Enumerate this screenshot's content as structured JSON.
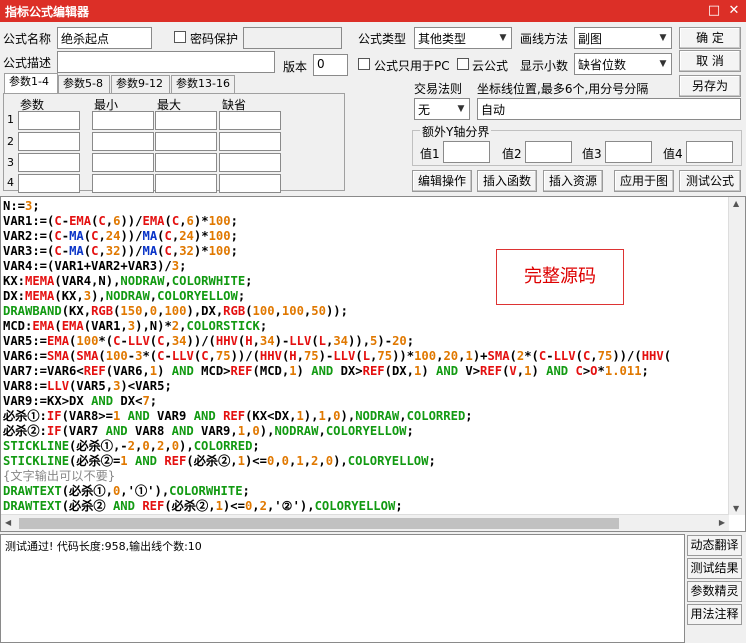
{
  "window": {
    "title": "指标公式编辑器",
    "restore_glyph": "□",
    "close_glyph": "✕"
  },
  "form": {
    "name_label": "公式名称",
    "name_value": "绝杀起点",
    "password_label": "密码保护",
    "desc_label": "公式描述",
    "desc_value": "",
    "version_label": "版本",
    "version_value": "0",
    "type_label": "公式类型",
    "type_value": "其他类型",
    "draw_label": "画线方法",
    "draw_value": "副图",
    "pc_only_label": "公式只用于PC",
    "cloud_label": "云公式",
    "decimal_label": "显示小数",
    "decimal_value": "缺省位数",
    "trade_rule_label": "交易法则",
    "trade_rule_value": "无",
    "coord_label": "坐标线位置,最多6个,用分号分隔",
    "coord_value": "自动",
    "yaxis_label": "额外Y轴分界",
    "val_labels": [
      "值1",
      "值2",
      "值3",
      "值4"
    ]
  },
  "buttons": {
    "ok": "确  定",
    "cancel": "取  消",
    "save_as": "另存为",
    "edit_op": "编辑操作",
    "insert_func": "插入函数",
    "insert_res": "插入资源",
    "apply_chart": "应用于图",
    "test": "测试公式"
  },
  "params": {
    "tabs": [
      "参数1-4",
      "参数5-8",
      "参数9-12",
      "参数13-16"
    ],
    "headers": [
      "参数",
      "最小",
      "最大",
      "缺省"
    ],
    "rows": [
      "1",
      "2",
      "3",
      "4"
    ]
  },
  "code_annotation": "完整源码",
  "code_lines": [
    [
      [
        "N:=",
        "blk"
      ],
      [
        "3",
        "org"
      ],
      [
        ";",
        "blk"
      ]
    ],
    [
      [
        "VAR1:=(",
        "blk"
      ],
      [
        "C",
        "red"
      ],
      [
        "-",
        "blk"
      ],
      [
        "EMA",
        "red"
      ],
      [
        "(",
        "blk"
      ],
      [
        "C",
        "red"
      ],
      [
        ",",
        "blk"
      ],
      [
        "6",
        "org"
      ],
      [
        ")",
        "blk"
      ],
      [
        ")/",
        "blk"
      ],
      [
        "EMA",
        "red"
      ],
      [
        "(",
        "blk"
      ],
      [
        "C",
        "red"
      ],
      [
        ",",
        "blk"
      ],
      [
        "6",
        "org"
      ],
      [
        ")*",
        "blk"
      ],
      [
        "100",
        "org"
      ],
      [
        ";",
        "blk"
      ]
    ],
    [
      [
        "VAR2:=(",
        "blk"
      ],
      [
        "C",
        "red"
      ],
      [
        "-",
        "blk"
      ],
      [
        "MA",
        "blu"
      ],
      [
        "(",
        "blk"
      ],
      [
        "C",
        "red"
      ],
      [
        ",",
        "blk"
      ],
      [
        "24",
        "org"
      ],
      [
        "))/",
        "blk"
      ],
      [
        "MA",
        "blu"
      ],
      [
        "(",
        "blk"
      ],
      [
        "C",
        "red"
      ],
      [
        ",",
        "blk"
      ],
      [
        "24",
        "org"
      ],
      [
        ")*",
        "blk"
      ],
      [
        "100",
        "org"
      ],
      [
        ";",
        "blk"
      ]
    ],
    [
      [
        "VAR3:=(",
        "blk"
      ],
      [
        "C",
        "red"
      ],
      [
        "-",
        "blk"
      ],
      [
        "MA",
        "blu"
      ],
      [
        "(",
        "blk"
      ],
      [
        "C",
        "red"
      ],
      [
        ",",
        "blk"
      ],
      [
        "32",
        "org"
      ],
      [
        "))/",
        "blk"
      ],
      [
        "MA",
        "blu"
      ],
      [
        "(",
        "blk"
      ],
      [
        "C",
        "red"
      ],
      [
        ",",
        "blk"
      ],
      [
        "32",
        "org"
      ],
      [
        ")*",
        "blk"
      ],
      [
        "100",
        "org"
      ],
      [
        ";",
        "blk"
      ]
    ],
    [
      [
        "VAR4:=(VAR1+VAR2+VAR3)/",
        "blk"
      ],
      [
        "3",
        "org"
      ],
      [
        ";",
        "blk"
      ]
    ],
    [
      [
        "KX:",
        "blk"
      ],
      [
        "MEMA",
        "red"
      ],
      [
        "(VAR4,N),",
        "blk"
      ],
      [
        "NODRAW",
        "grn"
      ],
      [
        ",",
        "blk"
      ],
      [
        "COLORWHITE",
        "grn"
      ],
      [
        ";",
        "blk"
      ]
    ],
    [
      [
        "DX:",
        "blk"
      ],
      [
        "MEMA",
        "red"
      ],
      [
        "(KX,",
        "blk"
      ],
      [
        "3",
        "org"
      ],
      [
        "),",
        "blk"
      ],
      [
        "NODRAW",
        "grn"
      ],
      [
        ",",
        "blk"
      ],
      [
        "COLORYELLOW",
        "grn"
      ],
      [
        ";",
        "blk"
      ]
    ],
    [
      [
        "DRAWBAND",
        "grn"
      ],
      [
        "(KX,",
        "blk"
      ],
      [
        "RGB",
        "red"
      ],
      [
        "(",
        "blk"
      ],
      [
        "150",
        "org"
      ],
      [
        ",",
        "blk"
      ],
      [
        "0",
        "org"
      ],
      [
        ",",
        "blk"
      ],
      [
        "100",
        "org"
      ],
      [
        "),DX,",
        "blk"
      ],
      [
        "RGB",
        "red"
      ],
      [
        "(",
        "blk"
      ],
      [
        "100",
        "org"
      ],
      [
        ",",
        "blk"
      ],
      [
        "100",
        "org"
      ],
      [
        ",",
        "blk"
      ],
      [
        "50",
        "org"
      ],
      [
        "));",
        "blk"
      ]
    ],
    [
      [
        "MCD:",
        "blk"
      ],
      [
        "EMA",
        "red"
      ],
      [
        "(",
        "blk"
      ],
      [
        "EMA",
        "red"
      ],
      [
        "(VAR1,",
        "blk"
      ],
      [
        "3",
        "org"
      ],
      [
        "),N)*",
        "blk"
      ],
      [
        "2",
        "org"
      ],
      [
        ",",
        "blk"
      ],
      [
        "COLORSTICK",
        "grn"
      ],
      [
        ";",
        "blk"
      ]
    ],
    [
      [
        "VAR5:=",
        "blk"
      ],
      [
        "EMA",
        "red"
      ],
      [
        "(",
        "blk"
      ],
      [
        "100",
        "org"
      ],
      [
        "*(",
        "blk"
      ],
      [
        "C",
        "red"
      ],
      [
        "-",
        "blk"
      ],
      [
        "LLV",
        "red"
      ],
      [
        "(",
        "blk"
      ],
      [
        "C",
        "red"
      ],
      [
        ",",
        "blk"
      ],
      [
        "34",
        "org"
      ],
      [
        "))/(",
        "blk"
      ],
      [
        "HHV",
        "red"
      ],
      [
        "(",
        "blk"
      ],
      [
        "H",
        "red"
      ],
      [
        ",",
        "blk"
      ],
      [
        "34",
        "org"
      ],
      [
        ")-",
        "blk"
      ],
      [
        "LLV",
        "red"
      ],
      [
        "(",
        "blk"
      ],
      [
        "L",
        "red"
      ],
      [
        ",",
        "blk"
      ],
      [
        "34",
        "org"
      ],
      [
        ")),",
        "blk"
      ],
      [
        "5",
        "org"
      ],
      [
        ")-",
        "blk"
      ],
      [
        "20",
        "org"
      ],
      [
        ";",
        "blk"
      ]
    ],
    [
      [
        "VAR6:=",
        "blk"
      ],
      [
        "SMA",
        "red"
      ],
      [
        "(",
        "blk"
      ],
      [
        "SMA",
        "red"
      ],
      [
        "(",
        "blk"
      ],
      [
        "100",
        "org"
      ],
      [
        "-",
        "blk"
      ],
      [
        "3",
        "org"
      ],
      [
        "*(",
        "blk"
      ],
      [
        "C",
        "red"
      ],
      [
        "-",
        "blk"
      ],
      [
        "LLV",
        "red"
      ],
      [
        "(",
        "blk"
      ],
      [
        "C",
        "red"
      ],
      [
        ",",
        "blk"
      ],
      [
        "75",
        "org"
      ],
      [
        "))/(",
        "blk"
      ],
      [
        "HHV",
        "red"
      ],
      [
        "(",
        "blk"
      ],
      [
        "H",
        "red"
      ],
      [
        ",",
        "blk"
      ],
      [
        "75",
        "org"
      ],
      [
        ")-",
        "blk"
      ],
      [
        "LLV",
        "red"
      ],
      [
        "(",
        "blk"
      ],
      [
        "L",
        "red"
      ],
      [
        ",",
        "blk"
      ],
      [
        "75",
        "org"
      ],
      [
        "))*",
        "blk"
      ],
      [
        "100",
        "org"
      ],
      [
        ",",
        "blk"
      ],
      [
        "20",
        "org"
      ],
      [
        ",",
        "blk"
      ],
      [
        "1",
        "org"
      ],
      [
        ")+",
        "blk"
      ],
      [
        "SMA",
        "red"
      ],
      [
        "(",
        "blk"
      ],
      [
        "2",
        "org"
      ],
      [
        "*(",
        "blk"
      ],
      [
        "C",
        "red"
      ],
      [
        "-",
        "blk"
      ],
      [
        "LLV",
        "red"
      ],
      [
        "(",
        "blk"
      ],
      [
        "C",
        "red"
      ],
      [
        ",",
        "blk"
      ],
      [
        "75",
        "org"
      ],
      [
        "))/(",
        "blk"
      ],
      [
        "HHV",
        "red"
      ],
      [
        "(",
        "blk"
      ]
    ],
    [
      [
        "VAR7:=VAR6<",
        "blk"
      ],
      [
        "REF",
        "red"
      ],
      [
        "(VAR6,",
        "blk"
      ],
      [
        "1",
        "org"
      ],
      [
        ") ",
        "blk"
      ],
      [
        "AND",
        "grn"
      ],
      [
        " MCD>",
        "blk"
      ],
      [
        "REF",
        "red"
      ],
      [
        "(MCD,",
        "blk"
      ],
      [
        "1",
        "org"
      ],
      [
        ") ",
        "blk"
      ],
      [
        "AND",
        "grn"
      ],
      [
        " DX>",
        "blk"
      ],
      [
        "REF",
        "red"
      ],
      [
        "(DX,",
        "blk"
      ],
      [
        "1",
        "org"
      ],
      [
        ") ",
        "blk"
      ],
      [
        "AND",
        "grn"
      ],
      [
        " V>",
        "blk"
      ],
      [
        "REF",
        "red"
      ],
      [
        "(",
        "blk"
      ],
      [
        "V",
        "red"
      ],
      [
        ",",
        "blk"
      ],
      [
        "1",
        "org"
      ],
      [
        ") ",
        "blk"
      ],
      [
        "AND",
        "grn"
      ],
      [
        " ",
        "blk"
      ],
      [
        "C",
        "red"
      ],
      [
        ">",
        "blk"
      ],
      [
        "O",
        "red"
      ],
      [
        "*",
        "blk"
      ],
      [
        "1.011",
        "org"
      ],
      [
        ";",
        "blk"
      ]
    ],
    [
      [
        "VAR8:=",
        "blk"
      ],
      [
        "LLV",
        "red"
      ],
      [
        "(VAR5,",
        "blk"
      ],
      [
        "3",
        "org"
      ],
      [
        ")<VAR5;",
        "blk"
      ]
    ],
    [
      [
        "VAR9:=KX>DX ",
        "blk"
      ],
      [
        "AND",
        "grn"
      ],
      [
        " DX<",
        "blk"
      ],
      [
        "7",
        "org"
      ],
      [
        ";",
        "blk"
      ]
    ],
    [
      [
        "必杀①:",
        "blk"
      ],
      [
        "IF",
        "red"
      ],
      [
        "(VAR8>=",
        "blk"
      ],
      [
        "1",
        "org"
      ],
      [
        " ",
        "blk"
      ],
      [
        "AND",
        "grn"
      ],
      [
        " VAR9 ",
        "blk"
      ],
      [
        "AND",
        "grn"
      ],
      [
        " ",
        "blk"
      ],
      [
        "REF",
        "red"
      ],
      [
        "(KX<DX,",
        "blk"
      ],
      [
        "1",
        "org"
      ],
      [
        "),",
        "blk"
      ],
      [
        "1",
        "org"
      ],
      [
        ",",
        "blk"
      ],
      [
        "0",
        "org"
      ],
      [
        "),",
        "blk"
      ],
      [
        "NODRAW",
        "grn"
      ],
      [
        ",",
        "blk"
      ],
      [
        "COLORRED",
        "grn"
      ],
      [
        ";",
        "blk"
      ]
    ],
    [
      [
        "必杀②:",
        "blk"
      ],
      [
        "IF",
        "red"
      ],
      [
        "(VAR7 ",
        "blk"
      ],
      [
        "AND",
        "grn"
      ],
      [
        " VAR8 ",
        "blk"
      ],
      [
        "AND",
        "grn"
      ],
      [
        " VAR9,",
        "blk"
      ],
      [
        "1",
        "org"
      ],
      [
        ",",
        "blk"
      ],
      [
        "0",
        "org"
      ],
      [
        "),",
        "blk"
      ],
      [
        "NODRAW",
        "grn"
      ],
      [
        ",",
        "blk"
      ],
      [
        "COLORYELLOW",
        "grn"
      ],
      [
        ";",
        "blk"
      ]
    ],
    [
      [
        "STICKLINE",
        "grn"
      ],
      [
        "(必杀①,-",
        "blk"
      ],
      [
        "2",
        "org"
      ],
      [
        ",",
        "blk"
      ],
      [
        "0",
        "org"
      ],
      [
        ",",
        "blk"
      ],
      [
        "2",
        "org"
      ],
      [
        ",",
        "blk"
      ],
      [
        "0",
        "org"
      ],
      [
        "),",
        "blk"
      ],
      [
        "COLORRED",
        "grn"
      ],
      [
        ";",
        "blk"
      ]
    ],
    [
      [
        "STICKLINE",
        "grn"
      ],
      [
        "(必杀②=",
        "blk"
      ],
      [
        "1",
        "org"
      ],
      [
        " ",
        "blk"
      ],
      [
        "AND",
        "grn"
      ],
      [
        " ",
        "blk"
      ],
      [
        "REF",
        "red"
      ],
      [
        "(必杀②,",
        "blk"
      ],
      [
        "1",
        "org"
      ],
      [
        ")<=",
        "blk"
      ],
      [
        "0",
        "org"
      ],
      [
        ",",
        "blk"
      ],
      [
        "0",
        "org"
      ],
      [
        ",",
        "blk"
      ],
      [
        "1",
        "org"
      ],
      [
        ",",
        "blk"
      ],
      [
        "2",
        "org"
      ],
      [
        ",",
        "blk"
      ],
      [
        "0",
        "org"
      ],
      [
        "),",
        "blk"
      ],
      [
        "COLORYELLOW",
        "grn"
      ],
      [
        ";",
        "blk"
      ]
    ],
    [
      [
        "{文字输出可以不要}",
        "gry"
      ]
    ],
    [
      [
        "DRAWTEXT",
        "grn"
      ],
      [
        "(必杀①,",
        "blk"
      ],
      [
        "0",
        "org"
      ],
      [
        ",'①'),",
        "blk"
      ],
      [
        "COLORWHITE",
        "grn"
      ],
      [
        ";",
        "blk"
      ]
    ],
    [
      [
        "DRAWTEXT",
        "grn"
      ],
      [
        "(必杀② ",
        "blk"
      ],
      [
        "AND",
        "grn"
      ],
      [
        " ",
        "blk"
      ],
      [
        "REF",
        "red"
      ],
      [
        "(必杀②,",
        "blk"
      ],
      [
        "1",
        "org"
      ],
      [
        ")<=",
        "blk"
      ],
      [
        "0",
        "org"
      ],
      [
        ",",
        "blk"
      ],
      [
        "2",
        "org"
      ],
      [
        ",'②'),",
        "blk"
      ],
      [
        "COLORYELLOW",
        "grn"
      ],
      [
        ";",
        "blk"
      ]
    ]
  ],
  "status_text": "测试通过! 代码长度:958,输出线个数:10",
  "side_buttons": [
    "动态翻译",
    "测试结果",
    "参数精灵",
    "用法注释"
  ],
  "colors": {
    "titlebar": "#dc2f27",
    "annotation_border": "#dd3333"
  }
}
